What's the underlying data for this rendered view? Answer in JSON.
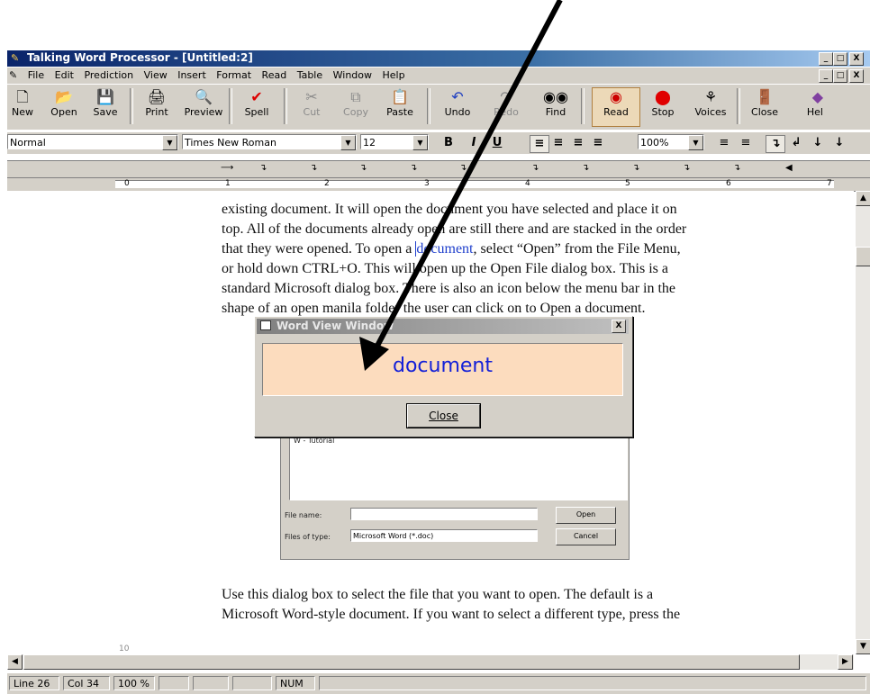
{
  "window": {
    "title": "Talking Word Processor - [Untitled:2]",
    "controls": [
      "_",
      "□",
      "X"
    ]
  },
  "menu": [
    "File",
    "Edit",
    "Prediction",
    "View",
    "Insert",
    "Format",
    "Read",
    "Table",
    "Window",
    "Help"
  ],
  "toolbar": {
    "new": "New",
    "open": "Open",
    "save": "Save",
    "print": "Print",
    "preview": "Preview",
    "spell": "Spell",
    "cut": "Cut",
    "copy": "Copy",
    "paste": "Paste",
    "undo": "Undo",
    "redo": "Redo",
    "find": "Find",
    "read": "Read",
    "stop": "Stop",
    "voices": "Voices",
    "close": "Close",
    "help": "Hel"
  },
  "format": {
    "style": "Normal",
    "font": "Times New Roman",
    "size": "12",
    "bold": "B",
    "italic": "I",
    "underline": "U",
    "zoom": "100%"
  },
  "ruler": {
    "numbers": [
      "0",
      "1",
      "2",
      "3",
      "4",
      "5",
      "6",
      "7"
    ]
  },
  "document": {
    "p1_lines": [
      "existing document.  It will open the document you have selected and place it on",
      "top.  All of the documents already open are still there and are stacked in the order",
      "that they were opened.  To open a ",
      "or hold down CTRL+O. This will open up the Open File dialog box.  This is a",
      "standard Microsoft dialog box.  There is also an icon below the menu bar in the",
      "shape of an open manila folder the user can click on to Open a document."
    ],
    "p1_highlight": "document",
    "p1_line3_tail": ", select “Open” from the File Menu,",
    "p2_lines": [
      "Use this dialog box to select the file that you want to open.  The default is a",
      "Microsoft Word-style document.  If you want to select a different type, press the"
    ],
    "page_number": "10"
  },
  "open_dialog": {
    "list_item": "W - Tutorial",
    "file_name_label": "File name:",
    "file_type_label": "Files of type:",
    "file_type_value": "Microsoft Word (*.doc)",
    "open_btn": "Open",
    "cancel_btn": "Cancel"
  },
  "word_view": {
    "title": "Word View Window",
    "word": "document",
    "close_btn": "Close"
  },
  "status": {
    "line": "Line 26",
    "col": "Col 34",
    "zoom": "100 %",
    "num": "NUM"
  }
}
